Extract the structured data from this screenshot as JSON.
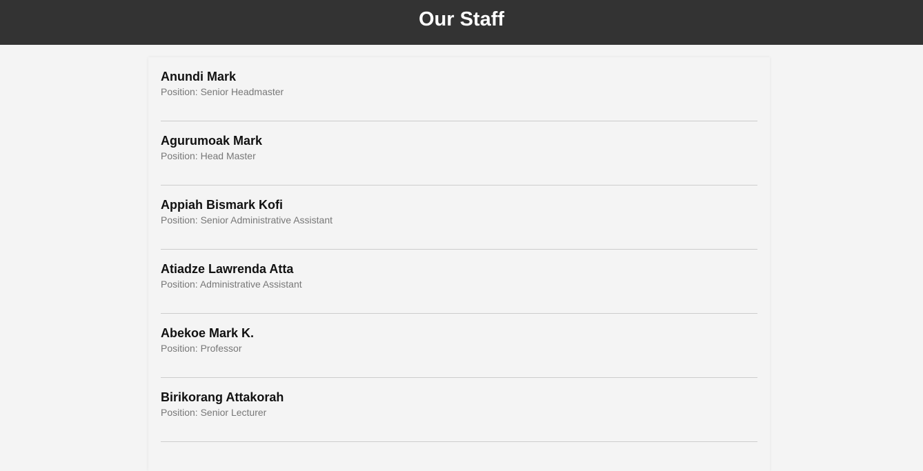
{
  "header": {
    "title": "Our Staff"
  },
  "staff": [
    {
      "name": "Anundi Mark",
      "position": "Position: Senior Headmaster"
    },
    {
      "name": "Agurumoak Mark",
      "position": "Position: Head Master"
    },
    {
      "name": "Appiah Bismark Kofi",
      "position": "Position: Senior Administrative Assistant"
    },
    {
      "name": "Atiadze Lawrenda Atta",
      "position": "Position: Administrative Assistant"
    },
    {
      "name": "Abekoe Mark K.",
      "position": "Position: Professor"
    },
    {
      "name": "Birikorang Attakorah",
      "position": "Position: Senior Lecturer"
    }
  ],
  "colors": {
    "header_bg": "#333333",
    "page_bg": "#f4f4f4",
    "name_text": "#111111",
    "position_text": "#777777",
    "divider": "#cccccc"
  }
}
